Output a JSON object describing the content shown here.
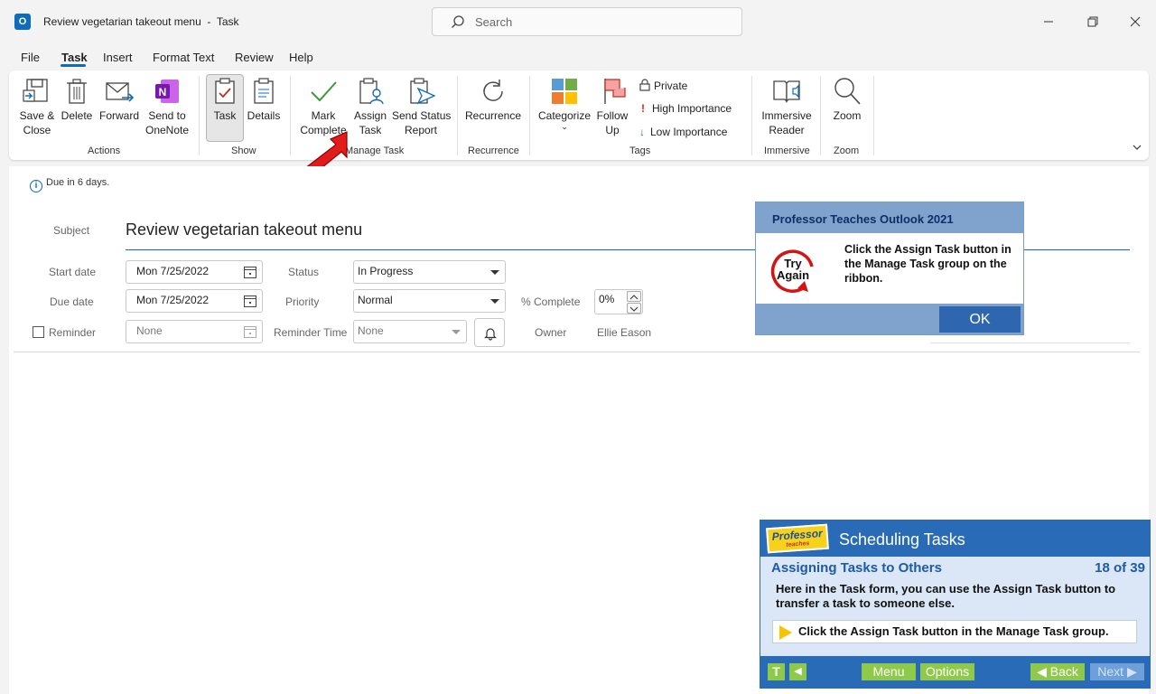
{
  "window": {
    "title": "Review vegetarian takeout menu  -  Task",
    "search_placeholder": "Search"
  },
  "menu": [
    "File",
    "Task",
    "Insert",
    "Format Text",
    "Review",
    "Help"
  ],
  "ribbon": {
    "actions": {
      "save_close": "Save &\nClose",
      "delete": "Delete",
      "forward": "Forward",
      "send_onenote": "Send to\nOneNote",
      "group": "Actions"
    },
    "show": {
      "task": "Task",
      "details": "Details",
      "group": "Show"
    },
    "manage": {
      "mark_complete": "Mark\nComplete",
      "assign_task": "Assign\nTask",
      "send_status": "Send Status\nReport",
      "group": "Manage Task"
    },
    "recurrence": {
      "recurrence": "Recurrence",
      "group": "Recurrence"
    },
    "tags": {
      "categorize": "Categorize",
      "follow_up": "Follow\nUp",
      "private": "Private",
      "high_importance": "High Importance",
      "low_importance": "Low Importance",
      "group": "Tags"
    },
    "immersive": {
      "reader": "Immersive\nReader",
      "group": "Immersive"
    },
    "zoom": {
      "zoom": "Zoom",
      "group": "Zoom"
    }
  },
  "form": {
    "info": "Due in 6 days.",
    "subject_label": "Subject",
    "subject_value": "Review vegetarian takeout menu",
    "start_label": "Start date",
    "start_value": "Mon 7/25/2022",
    "due_label": "Due date",
    "due_value": "Mon 7/25/2022",
    "status_label": "Status",
    "status_value": "In Progress",
    "priority_label": "Priority",
    "priority_value": "Normal",
    "complete_label": "% Complete",
    "complete_value": "0%",
    "reminder_label": "Reminder",
    "reminder_date": "None",
    "reminder_time_label": "Reminder Time",
    "reminder_time": "None",
    "owner_label": "Owner",
    "owner_value": "Ellie Eason"
  },
  "popup": {
    "header": "Professor Teaches Outlook 2021",
    "badge_line1": "Try",
    "badge_line2": "Again",
    "message": "Click the Assign Task button in the Manage Task group on the ribbon.",
    "ok": "OK"
  },
  "tutorial": {
    "logo_text": "Professor",
    "logo_sub": "teaches",
    "title": "Scheduling Tasks",
    "subtitle": "Assigning Tasks to Others",
    "counter": "18 of 39",
    "body": "Here in the Task form, you can use the Assign Task button to transfer a task to someone else.",
    "instruction": "Click the Assign Task button in the Manage Task group.",
    "btn_t": "T",
    "btn_back_small": "◀",
    "menu": "Menu",
    "options": "Options",
    "back": "◀ Back",
    "next": "Next ▶"
  }
}
